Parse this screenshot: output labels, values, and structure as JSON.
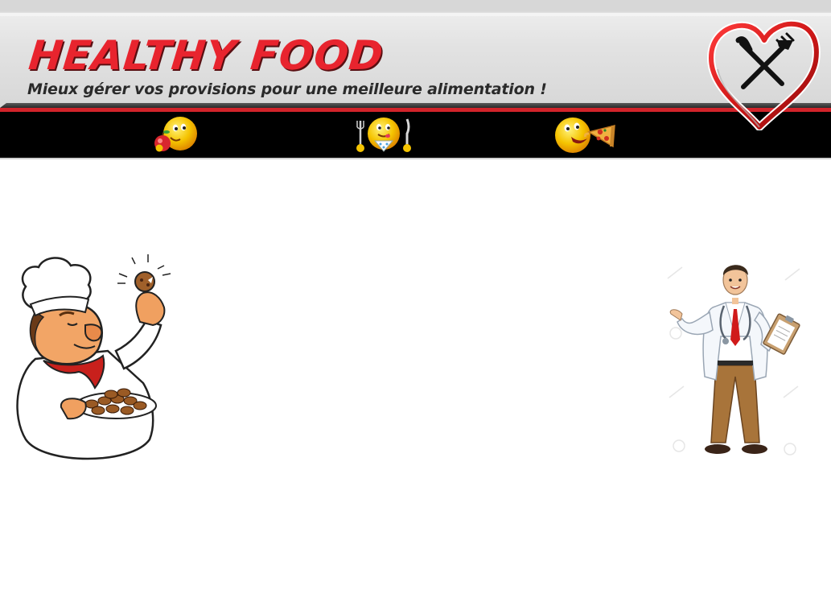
{
  "header": {
    "title": "HEALTHY FOOD",
    "subtitle": "Mieux gérer vos provisions pour une meilleure alimentation !"
  },
  "logo": {
    "icon": "heart-fork-knife-icon"
  },
  "nav": {
    "items": [
      {
        "icon": "emoji-eating-apple-icon"
      },
      {
        "icon": "emoji-with-fork-and-knife-icon"
      },
      {
        "icon": "emoji-eating-pizza-icon"
      }
    ]
  },
  "illustrations": {
    "left": "chef-with-cookies",
    "right": "doctor-with-clipboard"
  },
  "colors": {
    "brand_red": "#e8242e",
    "nav_background": "#000000",
    "header_background": "#e2e2e2"
  }
}
